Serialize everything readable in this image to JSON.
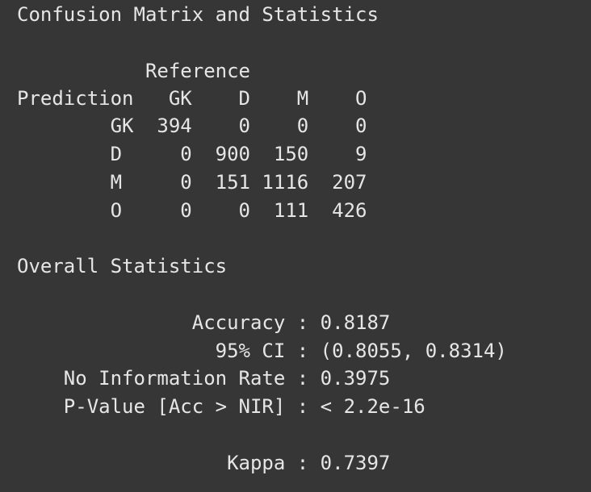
{
  "console": {
    "title": "Confusion Matrix and Statistics",
    "matrix": {
      "reference_header": "           Reference",
      "column_header": "Prediction   GK    D    M    O",
      "rows": [
        "        GK  394    0    0    0",
        "        D     0  900  150    9",
        "        M     0  151 1116  207",
        "        O     0    0  111  426"
      ]
    },
    "overall_heading": "Overall Statistics",
    "stats": {
      "accuracy": "               Accuracy : 0.8187",
      "ci": "                 95% CI : (0.8055, 0.8314)",
      "nir": "    No Information Rate : 0.3975",
      "pvalue": "    P-Value [Acc > NIR] : < 2.2e-16",
      "kappa": "                  Kappa : 0.7397"
    }
  }
}
